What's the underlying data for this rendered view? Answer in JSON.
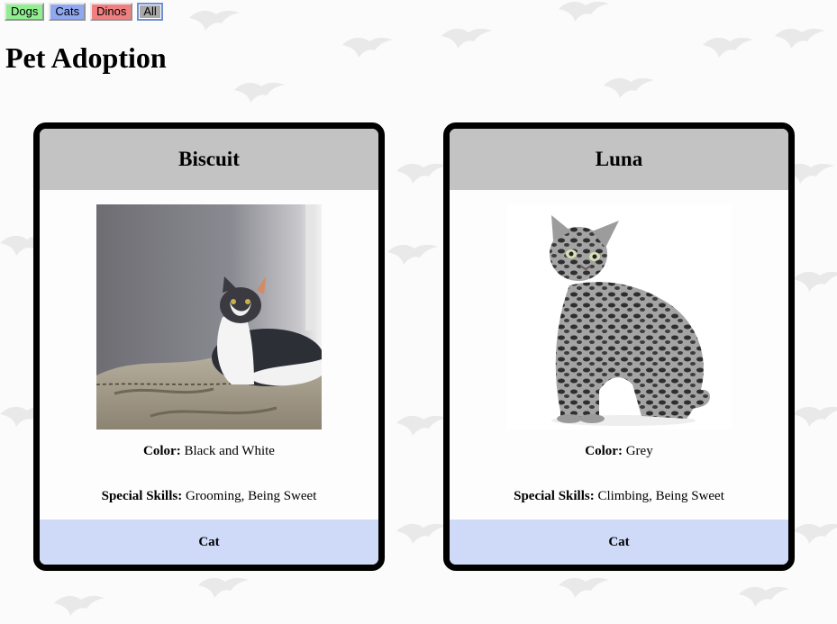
{
  "filters": {
    "dogs": "Dogs",
    "cats": "Cats",
    "dinos": "Dinos",
    "all": "All"
  },
  "page_title": "Pet Adoption",
  "pets": [
    {
      "name": "Biscuit",
      "color_label": "Color:",
      "color": "Black and White",
      "skills_label": "Special Skills:",
      "skills": "Grooming, Being Sweet",
      "type": "Cat"
    },
    {
      "name": "Luna",
      "color_label": "Color:",
      "color": "Grey",
      "skills_label": "Special Skills:",
      "skills": "Climbing, Being Sweet",
      "type": "Cat"
    }
  ],
  "colors": {
    "dogs_button": "#90ee90",
    "cats_button": "#8fa8f0",
    "dinos_button": "#f08080",
    "all_button": "#a9a9a9",
    "card_header": "#c3c3c3",
    "card_footer": "#cedaf8"
  }
}
